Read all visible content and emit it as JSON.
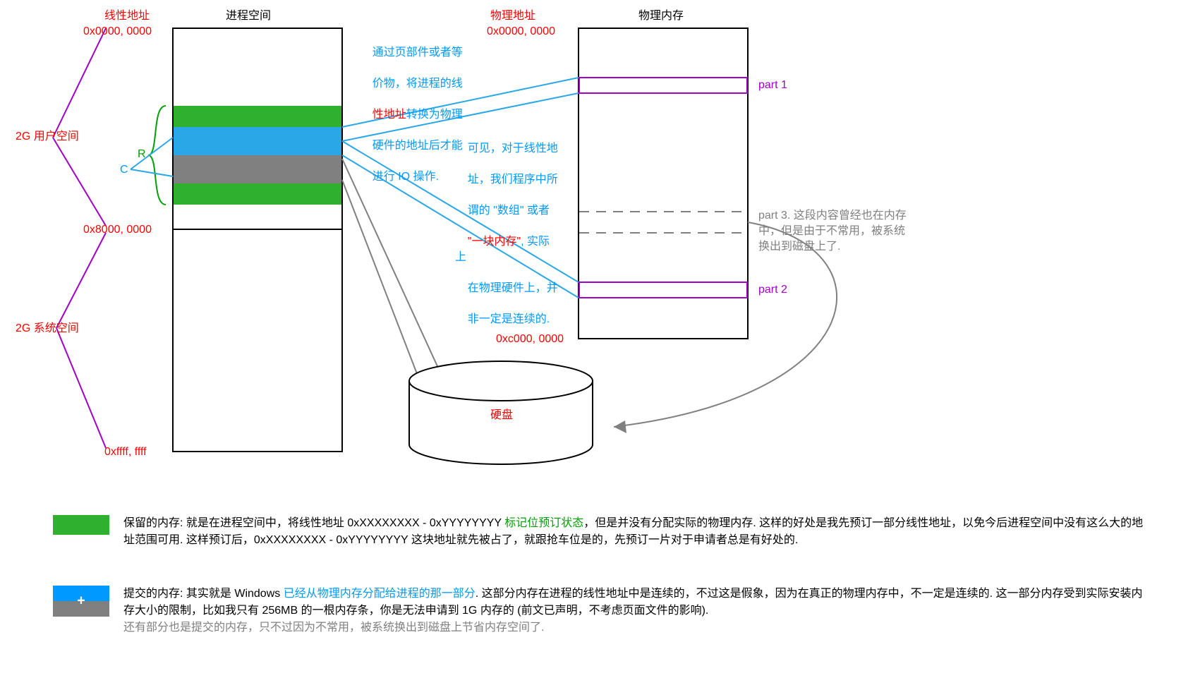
{
  "labels": {
    "linear_addr_title": "线性地址",
    "process_space_title": "进程空间",
    "physical_addr_title": "物理地址",
    "physical_mem_title": "物理内存",
    "addr0": "0x0000, 0000",
    "addr8": "0x8000, 0000",
    "addrF": "0xffff, ffff",
    "phys0": "0x0000, 0000",
    "physC": "0xc000, 0000",
    "user_space": "2G 用户空间",
    "sys_space": "2G 系统空间",
    "R": "R",
    "C": "C",
    "left_annot_line1": "通过页部件或者等",
    "left_annot_line2": "价物，将进程的线",
    "left_annot_line3a": "性地址",
    "left_annot_line3b": "转换为物理",
    "left_annot_line4": "硬件的地址后才能",
    "left_annot_line5": "进行 IO 操作.",
    "right_annot_line1": "可见，对于线性地",
    "right_annot_line2": "址，我们程序中所",
    "right_annot_line3a": "谓的 \"数组\" 或者",
    "right_annot_line4": "\"一块内存\"",
    "right_annot_line4b": ", 实际上",
    "right_annot_line5": "在物理硬件上，并",
    "right_annot_line6": "非一定是连续的.",
    "part1": "part 1",
    "part2": "part 2",
    "part3": "part 3. 这段内容曾经也在内存中，但是由于不常用，被系统换出到磁盘上了.",
    "disk_label": "硬盘",
    "legend_reserved": "保留的内存: 就是在进程空间中，将线性地址 0xXXXXXXXX - 0xYYYYYYYY ",
    "legend_reserved_green": "标记位预订状态",
    "legend_reserved_tail": "，但是并没有分配实际的物理内存. 这样的好处是我先预订一部分线性地址，以免今后进程空间中没有这么大的地址范围可用. 这样预订后，0xXXXXXXXX - 0xYYYYYYYY 这块地址就先被占了，就跟抢车位是的，先预订一片对于申请者总是有好处的.",
    "legend_commit": "提交的内存: 其实就是 Windows ",
    "legend_commit_blue": "已经从物理内存分配给进程的那一部分",
    "legend_commit_tail": ". 这部分内存在进程的线性地址中是连续的，不过这是假象，因为在真正的物理内存中，不一定是连续的. 这一部分内存受到实际安装内存大小的限制，比如我只有 256MB 的一根内存条，你是无法申请到 1G 内存的 (前文已声明，不考虑页面文件的影响).",
    "legend_commit_gray": "还有部分也是提交的内存，只不过因为不常用，被系统换出到磁盘上节省内存空间了."
  },
  "colors": {
    "green": "#2fb12f",
    "blue": "#2aa7e6",
    "gray": "#808080",
    "purple": "#a000c8",
    "red": "#ff0000"
  }
}
